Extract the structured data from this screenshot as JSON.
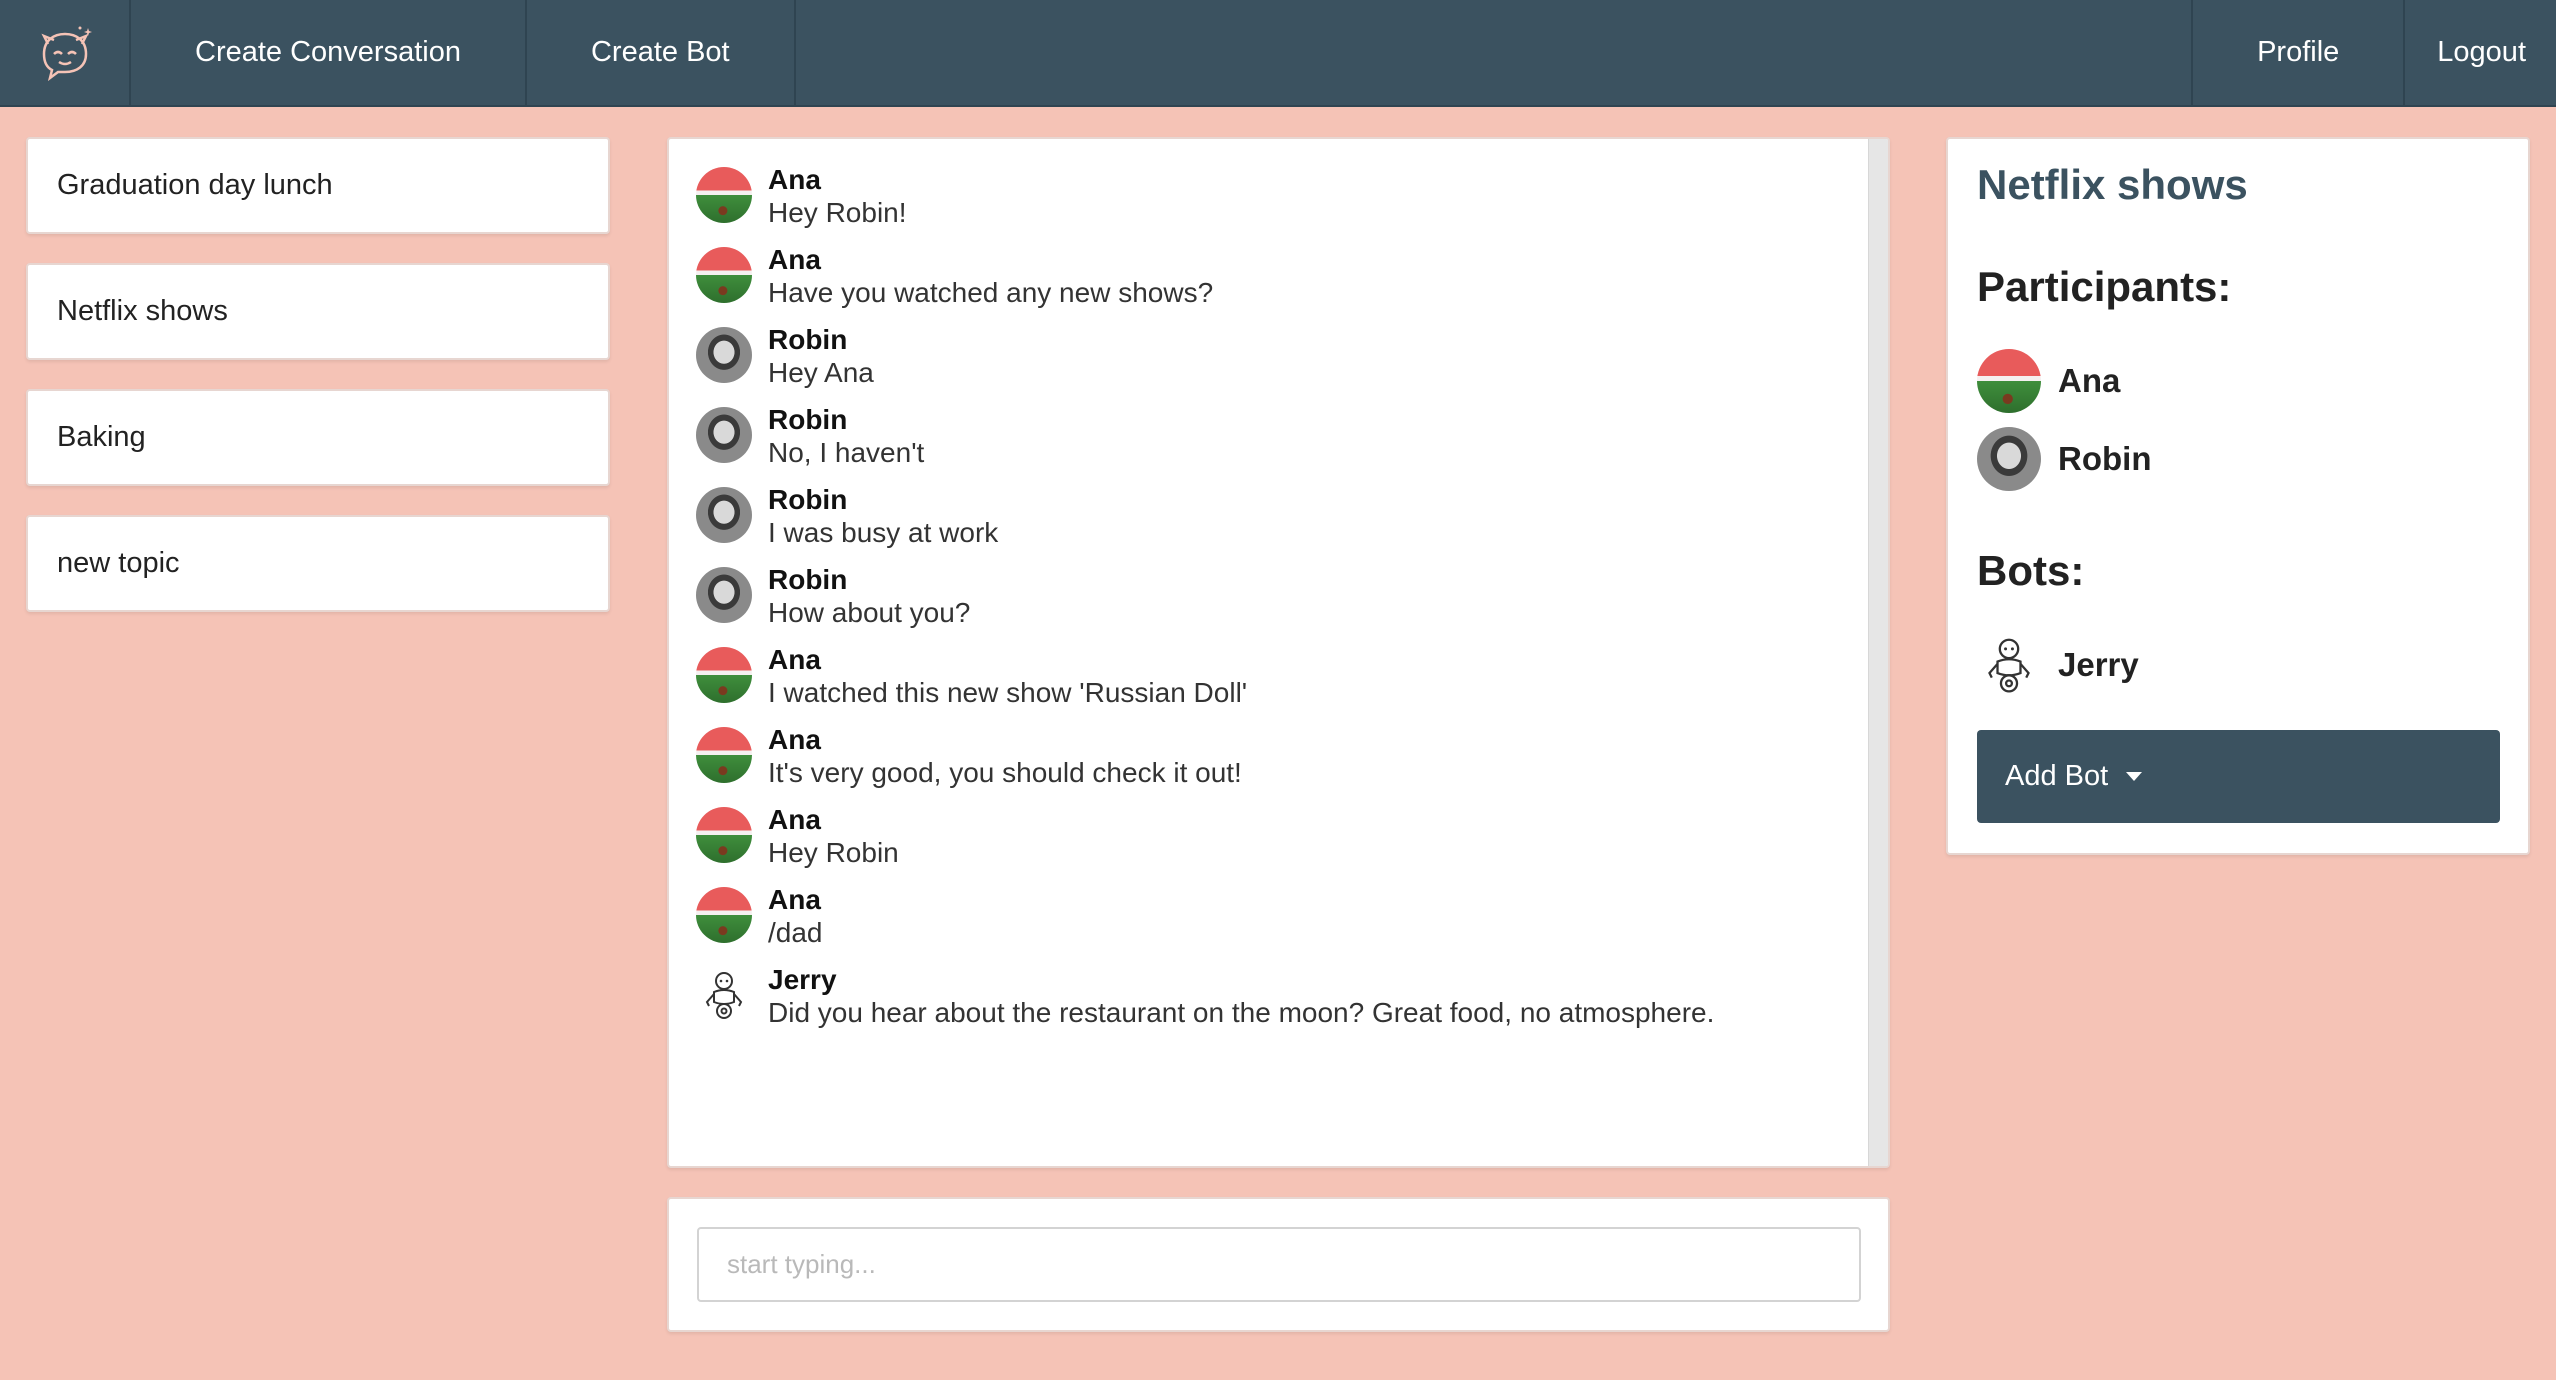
{
  "nav": {
    "logo_icon": "chat-face-icon",
    "create_conversation": "Create Conversation",
    "create_bot": "Create Bot",
    "profile": "Profile",
    "logout": "Logout"
  },
  "topics": [
    {
      "label": "Graduation day lunch"
    },
    {
      "label": "Netflix shows"
    },
    {
      "label": "Baking"
    },
    {
      "label": "new topic"
    }
  ],
  "messages": [
    {
      "author": "Ana",
      "text": "Hey Robin!",
      "avatar": "ana"
    },
    {
      "author": "Ana",
      "text": "Have you watched any new shows?",
      "avatar": "ana"
    },
    {
      "author": "Robin",
      "text": "Hey Ana",
      "avatar": "robin"
    },
    {
      "author": "Robin",
      "text": "No, I haven't",
      "avatar": "robin"
    },
    {
      "author": "Robin",
      "text": "I was busy at work",
      "avatar": "robin"
    },
    {
      "author": "Robin",
      "text": "How about you?",
      "avatar": "robin"
    },
    {
      "author": "Ana",
      "text": "I watched this new show 'Russian Doll'",
      "avatar": "ana"
    },
    {
      "author": "Ana",
      "text": "It's very good, you should check it out!",
      "avatar": "ana"
    },
    {
      "author": "Ana",
      "text": "Hey Robin",
      "avatar": "ana"
    },
    {
      "author": "Ana",
      "text": "/dad",
      "avatar": "ana"
    },
    {
      "author": "Jerry",
      "text": "Did you hear about the restaurant on the moon? Great food, no atmosphere.",
      "avatar": "bot"
    }
  ],
  "input": {
    "placeholder": "start typing...",
    "value": ""
  },
  "info": {
    "title": "Netflix shows",
    "participants_heading": "Participants:",
    "participants": [
      {
        "name": "Ana",
        "avatar": "ana"
      },
      {
        "name": "Robin",
        "avatar": "robin"
      }
    ],
    "bots_heading": "Bots:",
    "bots": [
      {
        "name": "Jerry",
        "icon": "robot-icon"
      }
    ],
    "add_bot_label": "Add Bot"
  },
  "colors": {
    "background": "#f5c3b6",
    "nav": "#3b5260",
    "accent": "#3b5260"
  }
}
